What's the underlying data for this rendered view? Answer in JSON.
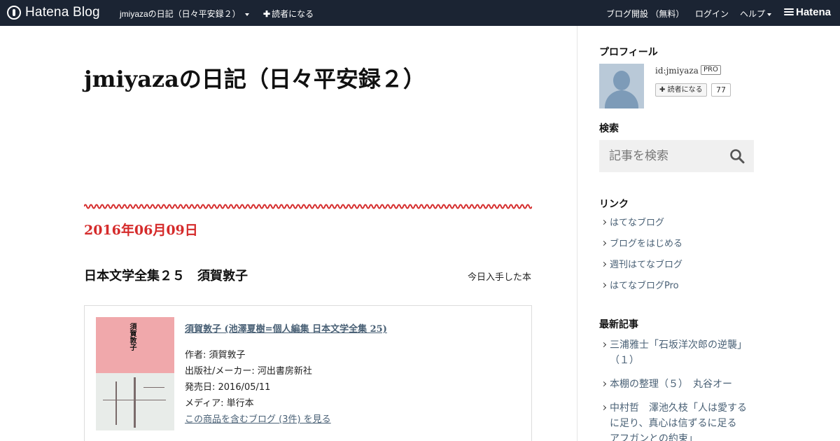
{
  "topbar": {
    "logo_text": "Hatena Blog",
    "blog_menu": "jmiyazaの日記（日々平安録２）",
    "subscribe": "読者になる",
    "open_blog": "ブログ開設 （無料）",
    "login": "ログイン",
    "help": "ヘルプ",
    "brand": "Hatena",
    "bg_color": "#1b2433"
  },
  "blog": {
    "title": "jmiyazaの日記（日々平安録２）"
  },
  "entry": {
    "date": "2016年06月09日",
    "title": "日本文学全集２５　須賀敦子",
    "category": "今日入手した本",
    "date_color": "#d52b2b",
    "product": {
      "link_text": "須賀敦子 (池澤夏樹=個人編集 日本文学全集 25)",
      "cover_title": "須賀敦子",
      "author": "作者: 須賀敦子",
      "publisher": "出版社/メーカー: 河出書房新社",
      "release": "発売日: 2016/05/11",
      "media": "メディア: 単行本",
      "more": "この商品を含むブログ (3件) を見る"
    }
  },
  "sidebar": {
    "profile_heading": "プロフィール",
    "profile_id": "id:jmiyaza",
    "pro_badge": "PRO",
    "reader_button": "読者になる",
    "reader_count": "77",
    "search_heading": "検索",
    "search_placeholder": "記事を検索",
    "links_heading": "リンク",
    "links": [
      "はてなブログ",
      "ブログをはじめる",
      "週刊はてなブログ",
      "はてなブログPro"
    ],
    "recent_heading": "最新記事",
    "recent": [
      "三浦雅士「石坂洋次郎の逆襲」（１）",
      "本棚の整理（５）　丸谷オー",
      "中村哲　澤池久枝「人は愛するに足り、真心は信ずるに足る　アフガンとの約束」"
    ]
  }
}
